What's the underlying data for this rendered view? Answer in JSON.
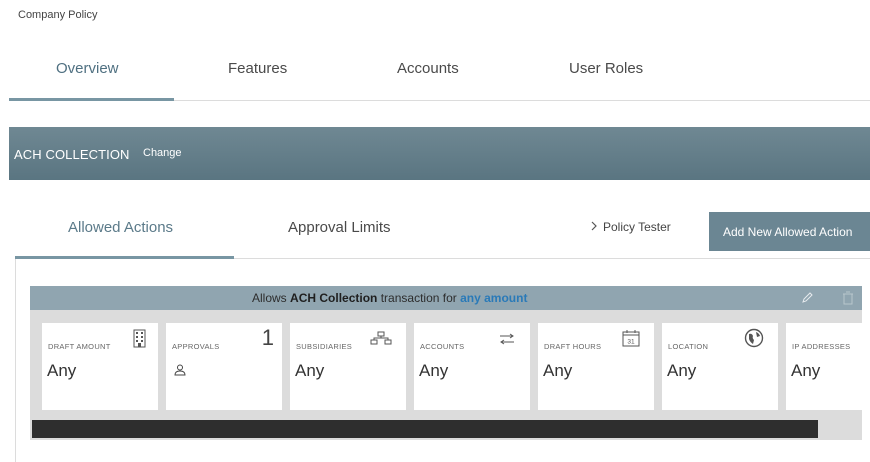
{
  "breadcrumb": "Company Policy",
  "main_tabs": [
    {
      "label": "Overview",
      "active": true
    },
    {
      "label": "Features",
      "active": false
    },
    {
      "label": "Accounts",
      "active": false
    },
    {
      "label": "User Roles",
      "active": false
    }
  ],
  "banner": {
    "title": "ACH COLLECTION",
    "change_label": "Change"
  },
  "sub_tabs": [
    {
      "label": "Allowed Actions",
      "active": true
    },
    {
      "label": "Approval Limits",
      "active": false
    }
  ],
  "policy_tester_label": "Policy Tester",
  "add_button_label": "Add New Allowed Action",
  "rule": {
    "prefix": "Allows",
    "transaction_type": "ACH Collection",
    "middle": "transaction for",
    "amount": "any amount",
    "cards": [
      {
        "label": "DRAFT AMOUNT",
        "value": "Any",
        "icon": "building-icon"
      },
      {
        "label": "APPROVALS",
        "value": "1",
        "icon": "user-icon"
      },
      {
        "label": "SUBSIDIARIES",
        "value": "Any",
        "icon": "hierarchy-icon"
      },
      {
        "label": "ACCOUNTS",
        "value": "Any",
        "icon": "transfer-arrows-icon"
      },
      {
        "label": "DRAFT HOURS",
        "value": "Any",
        "icon": "calendar-icon",
        "calendar_day": "31"
      },
      {
        "label": "LOCATION",
        "value": "Any",
        "icon": "globe-icon"
      },
      {
        "label": "IP ADDRESSES",
        "value": "Any",
        "icon": ""
      }
    ]
  },
  "colors": {
    "accent": "#4f7081",
    "banner": "#5f7a86",
    "rule_header": "#90a5b0",
    "amount_link": "#2a7ab8"
  }
}
